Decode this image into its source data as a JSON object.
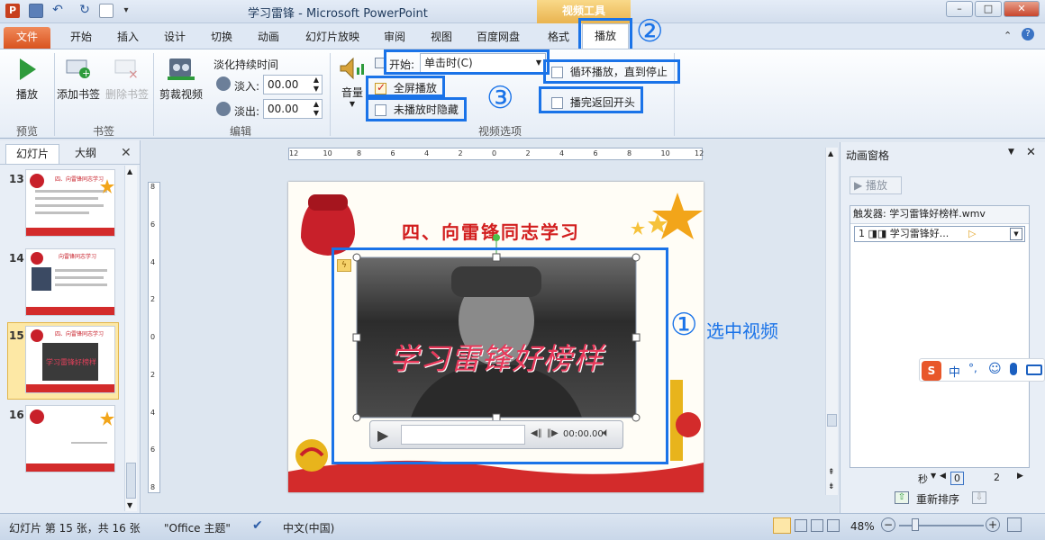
{
  "window": {
    "app_title": "学习雷锋 - Microsoft PowerPoint",
    "context_tool": "视频工具",
    "minimize": "–",
    "maximize": "□",
    "close": "✕"
  },
  "tabs": [
    "文件",
    "开始",
    "插入",
    "设计",
    "切换",
    "动画",
    "幻灯片放映",
    "审阅",
    "视图",
    "百度网盘",
    "格式",
    "播放"
  ],
  "ribbon": {
    "preview": {
      "play_label": "播放",
      "group": "预览"
    },
    "bookmarks": {
      "add_label": "添加书签",
      "remove_label": "删除书签",
      "group": "书签"
    },
    "edit": {
      "trim_label": "剪裁视频",
      "fade_title": "淡化持续时间",
      "fade_in_label": "淡入:",
      "fade_in_value": "00.00",
      "fade_out_label": "淡出:",
      "fade_out_value": "00.00",
      "group": "编辑"
    },
    "video_options": {
      "volume_label": "音量",
      "start_label": "开始:",
      "start_value": "单击时(C)",
      "fullscreen_label": "全屏播放",
      "hide_label": "未播放时隐藏",
      "loop_label": "循环播放，直到停止",
      "rewind_label": "播完返回开头",
      "group": "视频选项"
    }
  },
  "annotations": {
    "one": "①",
    "one_text": "选中视频",
    "two": "②",
    "three": "③"
  },
  "left_panel": {
    "tab_slides": "幻灯片",
    "tab_outline": "大纲",
    "slides": [
      {
        "num": "13",
        "title": "四、向雷锋同志学习"
      },
      {
        "num": "14",
        "title": "向雷锋同志学习"
      },
      {
        "num": "15",
        "title": "学习雷锋好榜样"
      },
      {
        "num": "16",
        "title": ""
      }
    ]
  },
  "ruler": {
    "h_ticks": [
      "12",
      "10",
      "8",
      "6",
      "4",
      "2",
      "0",
      "2",
      "4",
      "6",
      "8",
      "10",
      "12"
    ],
    "v_ticks": [
      "8",
      "6",
      "4",
      "2",
      "0",
      "2",
      "4",
      "6",
      "8"
    ]
  },
  "slide": {
    "title": "四、向雷锋同志学习",
    "video_caption": "学习雷锋好榜样",
    "player_time": "00:00.00"
  },
  "anim_pane": {
    "title": "动画窗格",
    "play_label": "播放",
    "trigger": "触发器: 学习雷锋好榜样.wmv",
    "item": "1 ◨◨ 学习雷锋好...",
    "seconds_label": "秒",
    "timeline_0": "0",
    "timeline_2": "2",
    "reorder_label": "重新排序"
  },
  "ime": {
    "zh": "中",
    "punct": "°,"
  },
  "status": {
    "slide_info": "幻灯片 第 15 张，共 16 张",
    "theme": "\"Office 主题\"",
    "language": "中文(中国)",
    "zoom": "48%"
  },
  "colors": {
    "accent_blue": "#1a73e8",
    "file_tab": "#d9531f",
    "slide_red": "#d21f1f"
  }
}
